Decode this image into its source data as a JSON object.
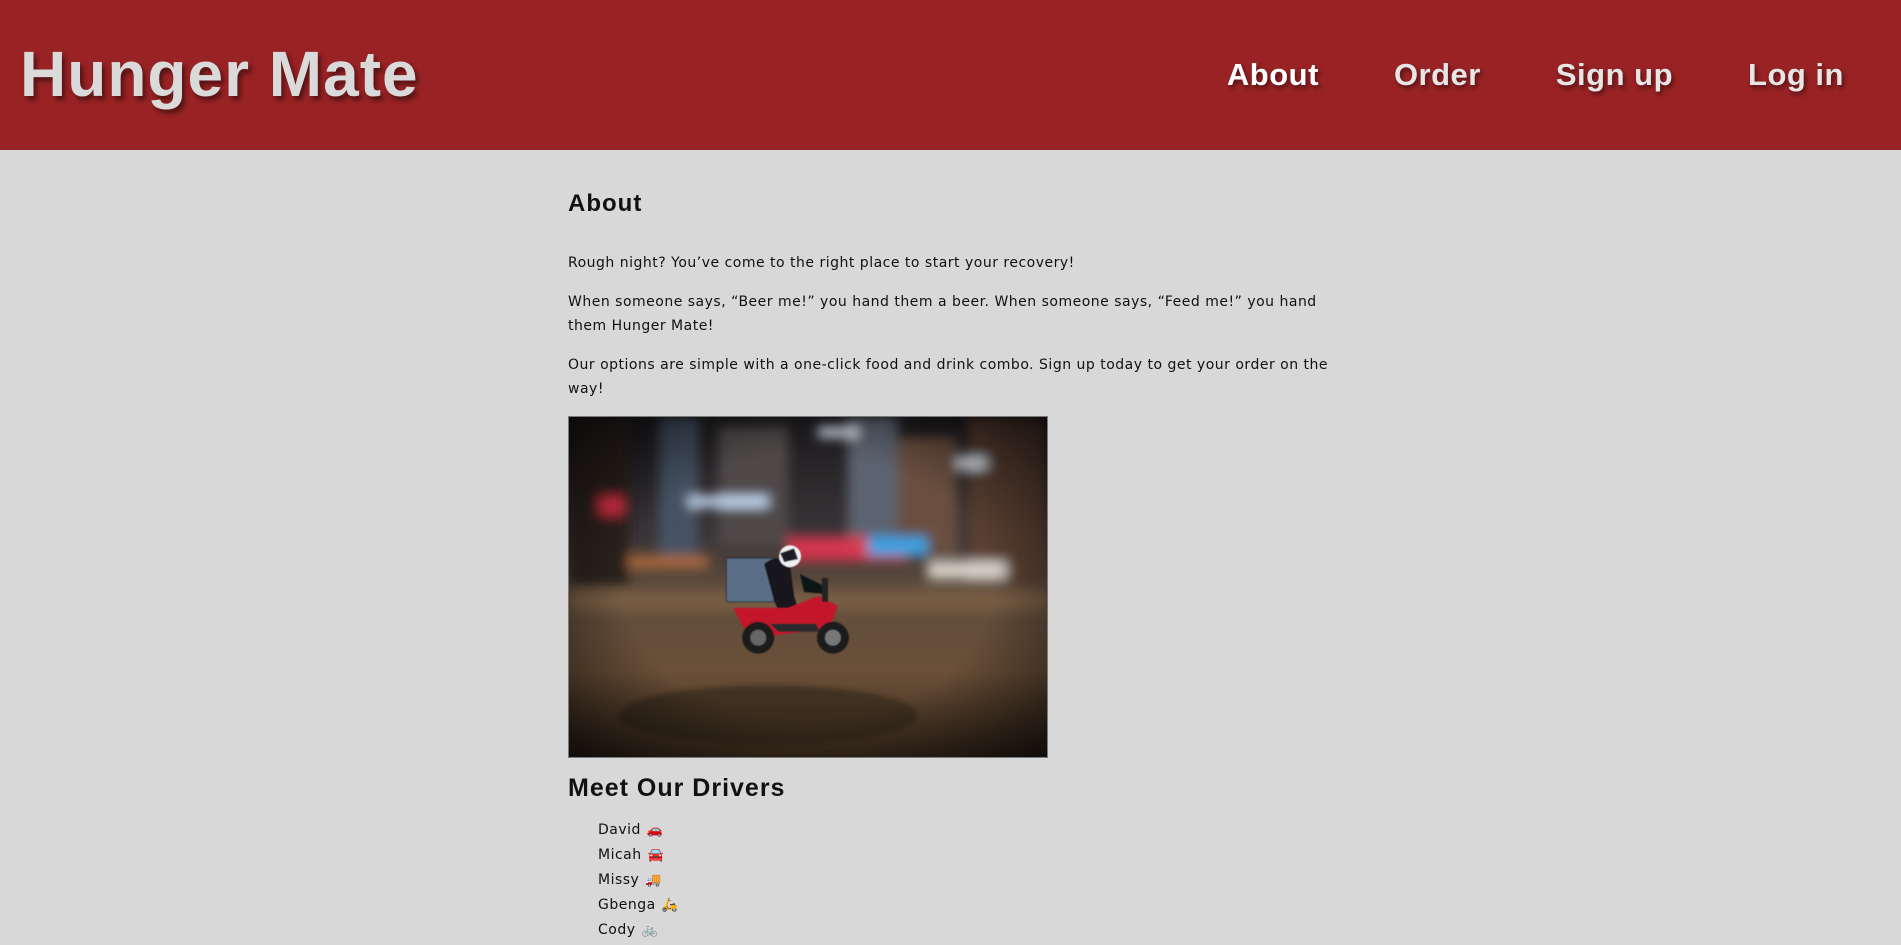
{
  "header": {
    "brand": "Hunger Mate",
    "nav": [
      {
        "label": "About",
        "active": true
      },
      {
        "label": "Order",
        "active": false
      },
      {
        "label": "Sign up",
        "active": false
      },
      {
        "label": "Log in",
        "active": false
      }
    ]
  },
  "about": {
    "heading": "About",
    "paragraphs": [
      "Rough night? You’ve come to the right place to start your recovery!",
      "When someone says, “Beer me!” you hand them a beer. When someone says, “Feed me!” you hand them Hunger Mate!",
      "Our options are simple with a one-click food and drink combo. Sign up today to get your order on the way!"
    ],
    "image_subject": "delivery-scooter-photo"
  },
  "drivers": {
    "heading": "Meet Our Drivers",
    "list": [
      {
        "name": "David",
        "vehicle_icon": "🚗"
      },
      {
        "name": "Micah",
        "vehicle_icon": "🚘"
      },
      {
        "name": "Missy",
        "vehicle_icon": "🚚"
      },
      {
        "name": "Gbenga",
        "vehicle_icon": "🛵"
      },
      {
        "name": "Cody",
        "vehicle_icon": "🚲"
      }
    ]
  },
  "colors": {
    "header_bg": "#982224",
    "page_bg": "#d8d8d8",
    "nav_text": "#e6e6e6"
  }
}
